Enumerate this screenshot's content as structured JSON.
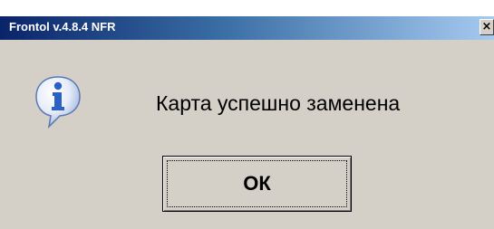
{
  "window": {
    "title": "Frontol v.4.8.4 NFR",
    "close_glyph": "×"
  },
  "dialog": {
    "icon": "info-icon",
    "message": "Карта успешно заменена",
    "ok_label": "ОК"
  },
  "colors": {
    "titlebar_start": "#0a246a",
    "titlebar_end": "#a6caf0",
    "dialog_background": "#d4d0c8",
    "icon_blue": "#2b62c2"
  }
}
